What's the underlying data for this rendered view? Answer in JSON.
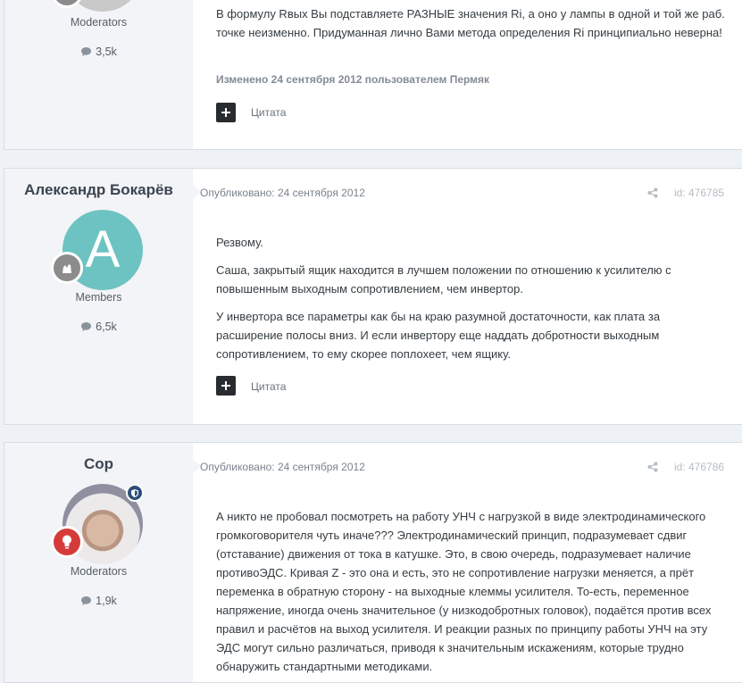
{
  "posts": [
    {
      "role": "Moderators",
      "count": "3,5k",
      "body": [
        "В формулу Rвых Вы подставляете РАЗНЫЕ значения Ri, а оно у лампы в одной и той же раб. точке неизменно. Придуманная лично Вами метода определения Ri принципиально неверна!"
      ],
      "edited": "Изменено 24 сентября 2012 пользователем Пермяк",
      "quote_label": "Цитата"
    },
    {
      "author": "Александр Бокарёв",
      "avatar_letter": "A",
      "role": "Members",
      "count": "6,5k",
      "published": "Опубликовано: 24 сентября 2012",
      "post_id": "id: 476785",
      "body": [
        "Резвому.",
        "Саша, закрытый ящик находится в лучшем положении по отношению к усилителю с повышенным выходным сопротивлением, чем инвертор.",
        "У инвертора все параметры как бы на краю разумной достаточности, как плата за расширение полосы вниз. И если инвертору еще наддать добротности выходным сопротивлением, то ему скорее поплохеет, чем ящику."
      ],
      "quote_label": "Цитата"
    },
    {
      "author": "Cop",
      "role": "Moderators",
      "count": "1,9k",
      "published": "Опубликовано: 24 сентября 2012",
      "post_id": "id: 476786",
      "body": [
        "А никто не пробовал посмотреть на работу УНЧ с нагрузкой в виде электродинамического громкоговорителя чуть иначе??? Электродинамический принцип, подразумевает сдвиг (отставание) движения от тока в катушке. Это, в свою очередь, подразумевает наличие противоЭДС. Кривая Z - это она и есть, это не сопротивление нагрузки меняется, а прёт переменка в обратную сторону - на выходные клеммы усилителя. То-есть, переменное напряжение, иногда очень значительное (у низкодобротных головок), подаётся против всех правил и расчётов на выход усилителя. И реакции разных по принципу работы УНЧ на эту ЭДС могут сильно различаться, приводя к значительным искажениям, которые трудно обнаружить стандартными методиками."
      ]
    }
  ],
  "colors": {
    "page_bg": "#eef1f5",
    "author_bg": "#f2f4f7",
    "avatar_teal": "#6dc3c1",
    "quote_button": "#282c31",
    "rank_red": "#d63b3b"
  }
}
